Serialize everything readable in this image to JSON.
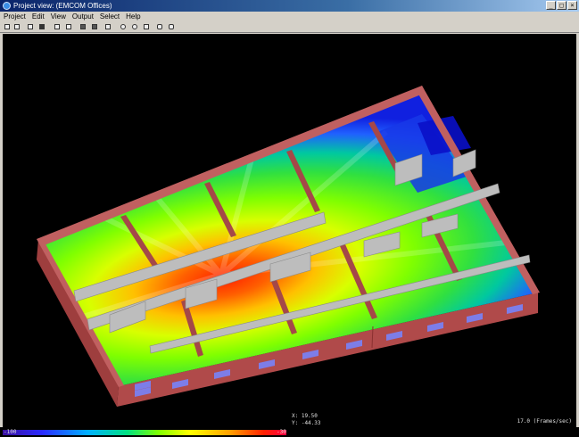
{
  "window": {
    "title": "Project view: (EMCOM Offices)",
    "controls": [
      "_",
      "□",
      "×"
    ]
  },
  "menu": [
    "Project",
    "Edit",
    "View",
    "Output",
    "Select",
    "Help"
  ],
  "toolbar": {
    "icons": [
      "new-project-icon",
      "open-icon",
      "window-icon",
      "save-icon",
      "copy-icon",
      "paste-icon",
      "print-icon",
      "export-icon",
      "settings-icon",
      "pan-icon",
      "rotate-icon",
      "zoom-icon",
      "transmitter-icon",
      "receiver-icon"
    ]
  },
  "status": {
    "legend_min": "-100",
    "legend_max": "-30",
    "coord_x": "X: 19.50",
    "coord_y": "Y: -44.33",
    "fps": "17.0 (Frames/sec)"
  },
  "colors": {
    "wall": "#b04a4a",
    "wall_top": "#c06060",
    "interior_wall": "#bdbdbd",
    "window": "#7d7de8",
    "background": "#000000"
  }
}
